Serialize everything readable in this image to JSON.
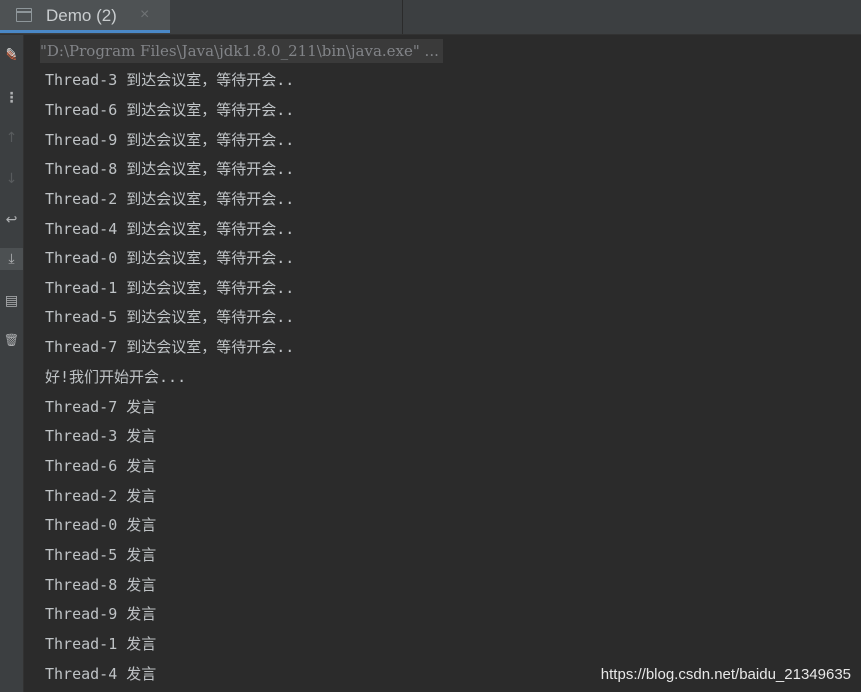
{
  "tab": {
    "title": "Demo (2)",
    "close_glyph": "×",
    "icon": "console-window-icon"
  },
  "toolbar": {
    "items": [
      {
        "name": "edit-icon",
        "glyph": "✎"
      },
      {
        "name": "more-icon",
        "glyph": "⋮"
      },
      {
        "name": "up-arrow-icon",
        "glyph": "↑"
      },
      {
        "name": "down-arrow-icon",
        "glyph": "↓"
      },
      {
        "name": "soft-wrap-icon",
        "glyph": "↩"
      },
      {
        "name": "scroll-to-end-icon",
        "glyph": "⤓"
      },
      {
        "name": "print-icon",
        "glyph": "▤"
      },
      {
        "name": "trash-icon",
        "glyph": "🗑"
      }
    ]
  },
  "console": {
    "command": "\"D:\\Program Files\\Java\\jdk1.8.0_211\\bin\\java.exe\" ...",
    "lines": [
      "Thread-3 到达会议室，等待开会..",
      "Thread-6 到达会议室，等待开会..",
      "Thread-9 到达会议室，等待开会..",
      "Thread-8 到达会议室，等待开会..",
      "Thread-2 到达会议室，等待开会..",
      "Thread-4 到达会议室，等待开会..",
      "Thread-0 到达会议室，等待开会..",
      "Thread-1 到达会议室，等待开会..",
      "Thread-5 到达会议室，等待开会..",
      "Thread-7 到达会议室，等待开会..",
      "好!我们开始开会...",
      "Thread-7 发言",
      "Thread-3 发言",
      "Thread-6 发言",
      "Thread-2 发言",
      "Thread-0 发言",
      "Thread-5 发言",
      "Thread-8 发言",
      "Thread-9 发言",
      "Thread-1 发言",
      "Thread-4 发言"
    ]
  },
  "watermark": "https://blog.csdn.net/baidu_21349635",
  "colors": {
    "background": "#2b2b2b",
    "text": "#bfc3c6",
    "tab_underline": "#4a88c7",
    "edit_icon_accent": "#e0643c"
  }
}
